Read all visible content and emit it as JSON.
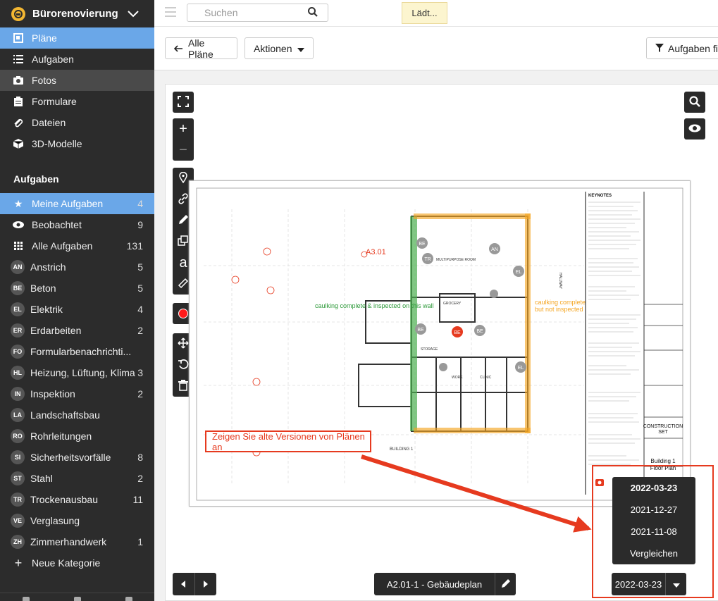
{
  "sidebar": {
    "project": "Bürorenovierung",
    "nav": [
      {
        "label": "Pläne",
        "icon": "plans-icon"
      },
      {
        "label": "Aufgaben",
        "icon": "list-icon"
      },
      {
        "label": "Fotos",
        "icon": "camera-icon"
      },
      {
        "label": "Formulare",
        "icon": "clipboard-icon"
      },
      {
        "label": "Dateien",
        "icon": "paperclip-icon"
      },
      {
        "label": "3D-Modelle",
        "icon": "cube-icon"
      }
    ],
    "section_title": "Aufgaben",
    "filters": [
      {
        "label": "Meine Aufgaben",
        "count": "4",
        "icon": "star-icon"
      },
      {
        "label": "Beobachtet",
        "count": "9",
        "icon": "eye-icon"
      },
      {
        "label": "Alle Aufgaben",
        "count": "131",
        "icon": "grid-icon"
      }
    ],
    "categories": [
      {
        "abbr": "AN",
        "label": "Anstrich",
        "count": "5"
      },
      {
        "abbr": "BE",
        "label": "Beton",
        "count": "5"
      },
      {
        "abbr": "EL",
        "label": "Elektrik",
        "count": "4"
      },
      {
        "abbr": "ER",
        "label": "Erdarbeiten",
        "count": "2"
      },
      {
        "abbr": "FO",
        "label": "Formularbenachrichti...",
        "count": ""
      },
      {
        "abbr": "HL",
        "label": "Heizung, Lüftung, Klima",
        "count": "3"
      },
      {
        "abbr": "IN",
        "label": "Inspektion",
        "count": "2"
      },
      {
        "abbr": "LA",
        "label": "Landschaftsbau",
        "count": ""
      },
      {
        "abbr": "RO",
        "label": "Rohrleitungen",
        "count": ""
      },
      {
        "abbr": "SI",
        "label": "Sicherheitsvorfälle",
        "count": "8"
      },
      {
        "abbr": "ST",
        "label": "Stahl",
        "count": "2"
      },
      {
        "abbr": "TR",
        "label": "Trockenausbau",
        "count": "11"
      },
      {
        "abbr": "VE",
        "label": "Verglasung",
        "count": ""
      },
      {
        "abbr": "ZH",
        "label": "Zimmerhandwerk",
        "count": "1"
      }
    ],
    "new_category": "Neue Kategorie"
  },
  "topbar": {
    "search_placeholder": "Suchen",
    "loading": "Lädt..."
  },
  "toolbar": {
    "back": "Alle Pläne",
    "actions": "Aktionen",
    "filter": "Aufgaben fil"
  },
  "viewer": {
    "callout": "Zeigen Sie alte Versionen von Plänen an",
    "plan_name": "A2.01-1 - Gebäudeplan",
    "current_version": "2022-03-23",
    "versions": [
      "2022-03-23",
      "2021-12-27",
      "2021-11-08"
    ],
    "compare": "Vergleichen"
  },
  "drawing": {
    "annotation_green": "caulking complete & inspected on this wall",
    "annotation_orange_1": "caulking complete",
    "annotation_orange_2": "but not inspected",
    "label_a301": "A3.01",
    "keynotes": "KEYNOTES",
    "title_block_1": "CONSTRUCTION",
    "title_block_2": "SET",
    "sheet_title_1": "Building 1",
    "sheet_title_2": "Floor Plan",
    "room_multipurpose": "MULTIPURPOSE ROOM",
    "room_grocery": "GROCERY",
    "room_storage": "STORAGE",
    "room_work": "WORK",
    "room_clinic": "CLINIC",
    "label_hallway": "HALLWAY",
    "building_label": "BUILDING 1",
    "pins": {
      "be1": "BE",
      "be2": "BE",
      "tr": "TR",
      "an": "AN",
      "el1": "EL",
      "el2": "EL",
      "be3": "BE",
      "be4": "BE",
      "el3": "EL"
    },
    "colors": {
      "green": "#4caf50",
      "orange": "#f5a623",
      "red": "#e63a1f"
    }
  }
}
